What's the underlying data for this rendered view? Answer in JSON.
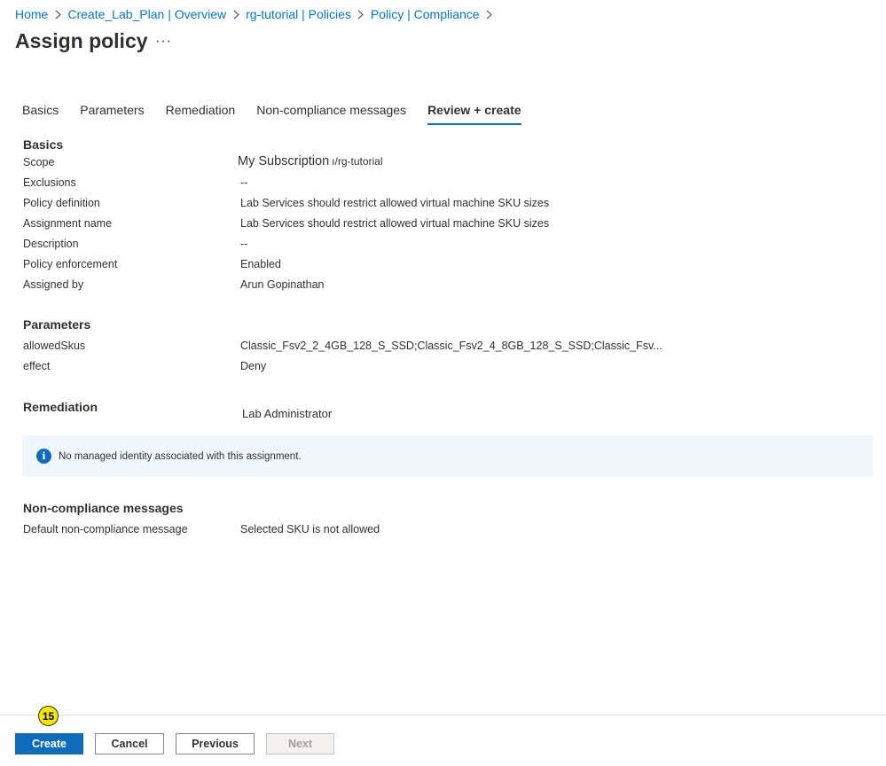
{
  "breadcrumb": [
    "Home",
    "Create_Lab_Plan | Overview",
    "rg-tutorial | Policies",
    "Policy | Compliance"
  ],
  "page": {
    "title": "Assign policy",
    "more_label": "···"
  },
  "tabs": [
    {
      "label": "Basics",
      "active": false
    },
    {
      "label": "Parameters",
      "active": false
    },
    {
      "label": "Remediation",
      "active": false
    },
    {
      "label": "Non-compliance messages",
      "active": false
    },
    {
      "label": "Review + create",
      "active": true
    }
  ],
  "basics": {
    "title": "Basics",
    "scope_label": "Scope",
    "scope_value": "My Subscription",
    "scope_suffix": "ı/rg-tutorial",
    "rows": [
      {
        "label": "Exclusions",
        "value": "--"
      },
      {
        "label": "Policy definition",
        "value": "Lab Services should restrict allowed virtual machine SKU sizes"
      },
      {
        "label": "Assignment name",
        "value": "Lab Services should restrict allowed virtual machine SKU sizes"
      },
      {
        "label": "Description",
        "value": "--"
      },
      {
        "label": "Policy enforcement",
        "value": "Enabled"
      },
      {
        "label": "Assigned by",
        "value": "Arun Gopinathan"
      }
    ]
  },
  "parameters": {
    "title": "Parameters",
    "rows": [
      {
        "label": "allowedSkus",
        "value": "Classic_Fsv2_2_4GB_128_S_SSD;Classic_Fsv2_4_8GB_128_S_SSD;Classic_Fsv..."
      },
      {
        "label": "effect",
        "value": "Deny"
      }
    ]
  },
  "remediation": {
    "title": "Remediation",
    "value": "Lab Administrator",
    "info_message": "No managed identity associated with this assignment."
  },
  "noncompliance": {
    "title": "Non-compliance messages",
    "rows": [
      {
        "label": "Default non-compliance message",
        "value": "Selected SKU is not allowed"
      }
    ]
  },
  "footer": {
    "create": "Create",
    "cancel": "Cancel",
    "previous": "Previous",
    "next": "Next",
    "step_badge": "15"
  },
  "colors": {
    "accent": "#0f6cbd",
    "link": "#0078d4",
    "info_bg": "#eff6fc",
    "badge": "#f5e800"
  },
  "icons": {
    "breadcrumb_separator": "chevron-right-icon",
    "info": "info-icon"
  }
}
